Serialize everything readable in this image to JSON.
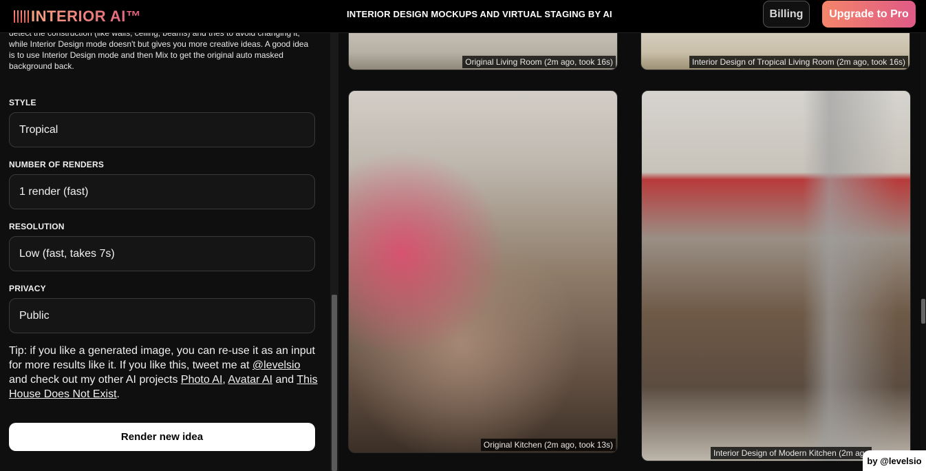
{
  "header": {
    "logo_text": "INTERIOR AI™",
    "title": "INTERIOR DESIGN MOCKUPS AND VIRTUAL STAGING BY AI",
    "billing_label": "Billing",
    "upgrade_label": "Upgrade to Pro"
  },
  "panel": {
    "description": "detect the construction (like walls, ceiling, beams) and tries to avoid changing it, while Interior Design mode doesn't but gives you more creative ideas. A good idea is to use Interior Design mode and then Mix to get the original auto masked background back.",
    "style": {
      "label": "STYLE",
      "value": "Tropical"
    },
    "renders": {
      "label": "NUMBER OF RENDERS",
      "value": "1 render (fast)"
    },
    "resolution": {
      "label": "RESOLUTION",
      "value": "Low (fast, takes 7s)"
    },
    "privacy": {
      "label": "PRIVACY",
      "value": "Public"
    },
    "tip": {
      "text1": "Tip: if you like a generated image, you can re-use it as an input for more results like it. If you like this, tweet me at ",
      "link_twitter": "@levelsio",
      "text2": " and check out my other AI projects ",
      "link_photo": "Photo AI",
      "comma": ", ",
      "link_avatar": "Avatar AI",
      "text3": " and ",
      "link_house": "This House Does Not Exist",
      "period": "."
    },
    "render_button": "Render new idea"
  },
  "gallery": {
    "items": [
      {
        "caption": "Original Living Room (2m ago, took 16s)"
      },
      {
        "caption": "Interior Design of Tropical Living Room (2m ago, took 16s)"
      },
      {
        "caption": "Original Kitchen (2m ago, took 13s)"
      },
      {
        "caption": "Interior Design of Modern Kitchen (2m ago"
      }
    ]
  },
  "badge": {
    "text": "by @levelsio"
  },
  "colors": {
    "accent_gradient_start": "#f4856a",
    "accent_gradient_end": "#e05a86",
    "background": "#0d0d0d"
  }
}
